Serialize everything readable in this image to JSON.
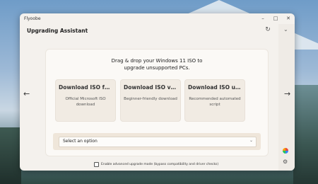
{
  "window": {
    "app_title": "Flyoobe"
  },
  "header": {
    "title": "Upgrading Assistant"
  },
  "main": {
    "instructions_line1": "Drag & drop your Windows 11 ISO to",
    "instructions_line2": "upgrade unsupported PCs.",
    "options": [
      {
        "title": "Download ISO fro...",
        "description": "Official Microsoft ISO download"
      },
      {
        "title": "Download ISO via...",
        "description": "Beginner-friendly download"
      },
      {
        "title": "Download ISO usi...",
        "description": "Recommended automated script"
      }
    ],
    "select": {
      "value": "Select an option"
    },
    "advanced_mode_label": "Enable advanced upgrade mode (bypass compatibility and driver checks)"
  },
  "icons": {
    "minimize": "minimize-icon",
    "maximize": "maximize-icon",
    "close": "close-icon",
    "refresh": "refresh-icon",
    "chevron_down": "chevron-down-icon",
    "nav_left": "arrow-left-icon",
    "nav_right": "arrow-right-icon",
    "copilot": "copilot-icon",
    "settings": "settings-icon"
  }
}
